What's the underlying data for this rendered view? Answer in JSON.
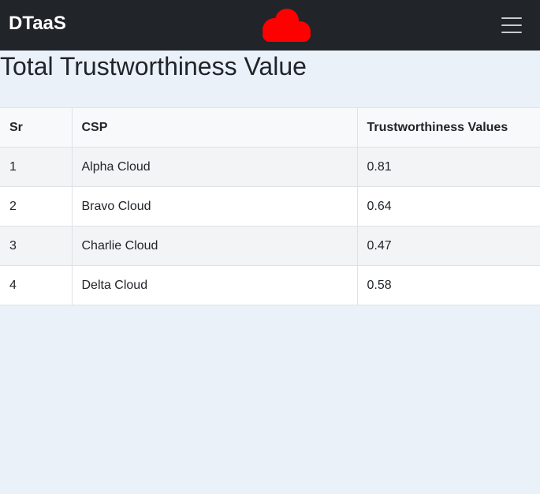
{
  "navbar": {
    "brand": "DTaaS",
    "logo_icon": "cloud-icon",
    "logo_color": "#ff0000",
    "menu_icon": "hamburger-menu-icon"
  },
  "page": {
    "title": "Total Trustworthiness Value"
  },
  "table": {
    "headers": {
      "sr": "Sr",
      "csp": "CSP",
      "value": "Trustworthiness Values"
    },
    "rows": [
      {
        "sr": "1",
        "csp": "Alpha Cloud",
        "value": "0.81"
      },
      {
        "sr": "2",
        "csp": "Bravo Cloud",
        "value": "0.64"
      },
      {
        "sr": "3",
        "csp": "Charlie Cloud",
        "value": "0.47"
      },
      {
        "sr": "4",
        "csp": "Delta Cloud",
        "value": "0.58"
      }
    ]
  },
  "colors": {
    "navbar_bg": "#212529",
    "page_bg": "#ebf1f9",
    "text": "#212529"
  }
}
